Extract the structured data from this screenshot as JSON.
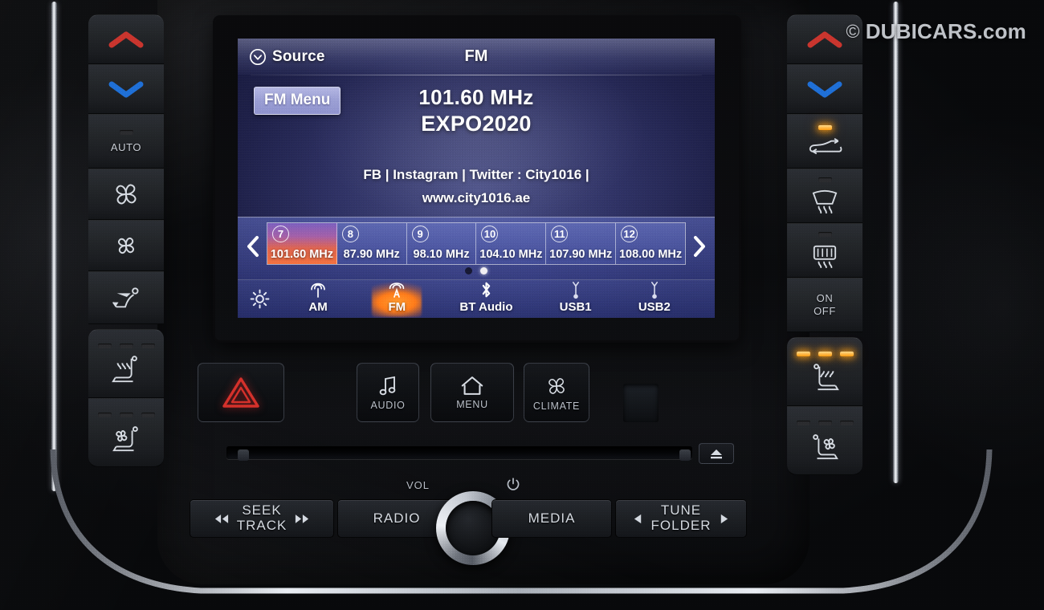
{
  "watermark": {
    "copyright": "©",
    "text": "DUBICARS.com"
  },
  "screen": {
    "header": {
      "source_label": "Source",
      "source_icon": "chevron-down-circle-icon",
      "title": "FM"
    },
    "fm_menu_label": "FM Menu",
    "now_playing": {
      "frequency": "101.60 MHz",
      "station": "EXPO2020",
      "rds_line1": "FB | Instagram | Twitter : City1016 |",
      "rds_line2": "www.city1016.ae"
    },
    "preset_nav": {
      "prev_icon": "chevron-left-icon",
      "next_icon": "chevron-right-icon"
    },
    "presets": [
      {
        "number": "7",
        "freq": "101.60 MHz",
        "active": true
      },
      {
        "number": "8",
        "freq": "87.90 MHz",
        "active": false
      },
      {
        "number": "9",
        "freq": "98.10 MHz",
        "active": false
      },
      {
        "number": "10",
        "freq": "104.10 MHz",
        "active": false
      },
      {
        "number": "11",
        "freq": "107.90 MHz",
        "active": false
      },
      {
        "number": "12",
        "freq": "108.00 MHz",
        "active": false
      }
    ],
    "page_dots": [
      {
        "active": false
      },
      {
        "active": true
      }
    ],
    "source_bar": {
      "settings_icon": "gear-icon",
      "items": [
        {
          "label": "AM",
          "icon": "am-antenna-icon",
          "active": false
        },
        {
          "label": "FM",
          "icon": "fm-antenna-icon",
          "active": true
        },
        {
          "label": "BT Audio",
          "icon": "bluetooth-icon",
          "active": false
        },
        {
          "label": "USB1",
          "icon": "usb-icon",
          "active": false
        },
        {
          "label": "USB2",
          "icon": "usb-icon",
          "active": false
        }
      ]
    },
    "colors": {
      "screen_bg": "#2e3163",
      "accent_orange": "#ff7a18",
      "preset_active_start": "#7b5fbe",
      "preset_active_end": "#f4713f",
      "fm_menu_bg": "#9a9ed4"
    }
  },
  "left_keys": [
    {
      "name": "temp-up",
      "icon": "chevron-up-red-icon",
      "label": "",
      "leds": 0,
      "leds_on": 0
    },
    {
      "name": "temp-down",
      "icon": "chevron-down-blue-icon",
      "label": "",
      "leds": 0,
      "leds_on": 0
    },
    {
      "name": "auto",
      "icon": "indicator-bar-icon",
      "label": "AUTO",
      "leds": 1,
      "leds_on": 0
    },
    {
      "name": "fan-up",
      "icon": "fan-large-icon",
      "label": "",
      "leds": 0,
      "leds_on": 0
    },
    {
      "name": "fan-down",
      "icon": "fan-small-icon",
      "label": "",
      "leds": 0,
      "leds_on": 0
    },
    {
      "name": "airflow-mode",
      "icon": "airflow-seat-icon",
      "label": "",
      "leds": 0,
      "leds_on": 0
    },
    {
      "name": "heated-seat-left",
      "icon": "heated-seat-icon",
      "label": "",
      "leds": 3,
      "leds_on": 0
    },
    {
      "name": "cooled-seat-left",
      "icon": "ventilated-seat-icon",
      "label": "",
      "leds": 3,
      "leds_on": 0
    }
  ],
  "right_keys": [
    {
      "name": "temp-up",
      "icon": "chevron-up-red-icon",
      "label": "",
      "leds": 0,
      "leds_on": 0
    },
    {
      "name": "temp-down",
      "icon": "chevron-down-blue-icon",
      "label": "",
      "leds": 0,
      "leds_on": 0
    },
    {
      "name": "recirculation",
      "icon": "recirculation-icon",
      "label": "",
      "leds": 1,
      "leds_on": 1
    },
    {
      "name": "front-defrost",
      "icon": "front-defrost-icon",
      "label": "",
      "leds": 1,
      "leds_on": 0
    },
    {
      "name": "rear-defrost",
      "icon": "rear-defrost-icon",
      "label": "",
      "leds": 1,
      "leds_on": 0
    },
    {
      "name": "climate-on-off",
      "icon": "",
      "label": "ON\nOFF",
      "leds": 0,
      "leds_on": 0
    },
    {
      "name": "heated-seat-right",
      "icon": "heated-seat-icon",
      "label": "",
      "leds": 3,
      "leds_on": 3
    },
    {
      "name": "cooled-seat-right",
      "icon": "ventilated-seat-icon",
      "label": "",
      "leds": 3,
      "leds_on": 0
    }
  ],
  "on_off_label_line1": "ON",
  "on_off_label_line2": "OFF",
  "auto_label": "AUTO",
  "function_buttons": [
    {
      "name": "hazard",
      "icon": "hazard-triangle-icon",
      "label": ""
    },
    {
      "name": "audio",
      "icon": "music-note-icon",
      "label": "AUDIO"
    },
    {
      "name": "menu",
      "icon": "home-icon",
      "label": "MENU"
    },
    {
      "name": "climate",
      "icon": "fan-icon",
      "label": "CLIMATE"
    }
  ],
  "media_deck": {
    "eject_icon": "eject-icon",
    "vol_label": "VOL",
    "power_icon": "power-icon",
    "seek": {
      "label_line1": "SEEK",
      "label_line2": "TRACK",
      "prev_icon": "skip-back-icon",
      "next_icon": "skip-forward-icon"
    },
    "radio_label": "RADIO",
    "media_label": "MEDIA",
    "tune": {
      "label_line1": "TUNE",
      "label_line2": "FOLDER",
      "left_icon": "triangle-left-icon",
      "right_icon": "triangle-right-icon"
    }
  }
}
